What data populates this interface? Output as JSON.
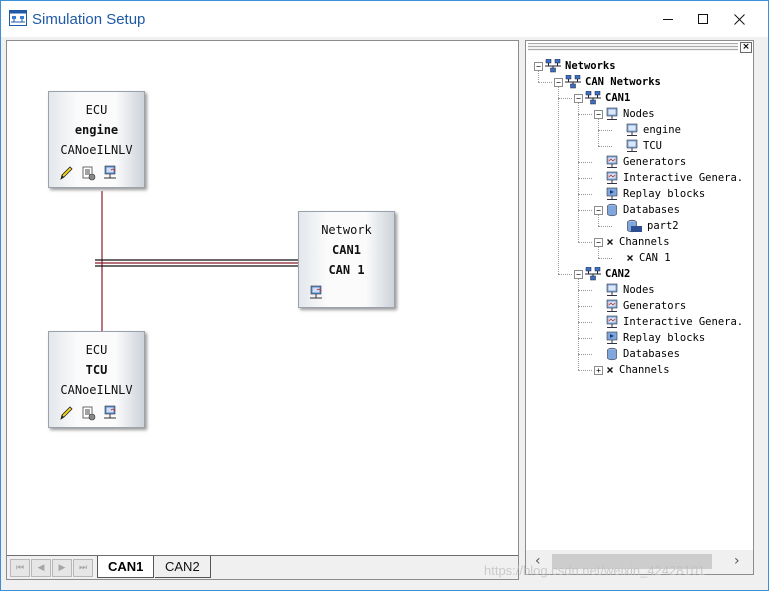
{
  "window": {
    "title": "Simulation Setup",
    "controls": {
      "minimize": "—",
      "maximize": "☐",
      "close": "✕"
    }
  },
  "canvas": {
    "blocks": [
      {
        "id": "ecu-engine",
        "line1": "ECU",
        "line2": "engine",
        "line3": "CANoeILNLV",
        "icons": [
          "pencil-icon",
          "configure-icon",
          "network-node-icon"
        ]
      },
      {
        "id": "network-can1",
        "line1": "Network",
        "line2": "CAN1",
        "line3": "CAN 1",
        "icons": [
          "network-node-icon"
        ]
      },
      {
        "id": "ecu-tcu",
        "line1": "ECU",
        "line2": "TCU",
        "line3": "CANoeILNLV",
        "icons": [
          "pencil-icon",
          "configure-icon",
          "network-node-icon"
        ]
      }
    ],
    "bus_color": "#8b1a2b"
  },
  "tabs": {
    "nav": [
      "⏮",
      "◀",
      "▶",
      "⏭"
    ],
    "items": [
      {
        "label": "CAN1",
        "active": true
      },
      {
        "label": "CAN2",
        "active": false
      }
    ]
  },
  "tree": {
    "nodes": [
      {
        "label": "Networks",
        "bold": true,
        "icon": "networks-icon",
        "expander": "−"
      },
      {
        "label": "CAN Networks",
        "bold": true,
        "icon": "networks-icon",
        "expander": "−"
      },
      {
        "label": "CAN1",
        "bold": true,
        "icon": "networks-icon",
        "expander": "−"
      },
      {
        "label": "Nodes",
        "bold": false,
        "icon": "computer-icon",
        "expander": "−"
      },
      {
        "label": "engine",
        "bold": false,
        "icon": "computer-icon",
        "expander": ""
      },
      {
        "label": "TCU",
        "bold": false,
        "icon": "computer-icon",
        "expander": ""
      },
      {
        "label": "Generators",
        "bold": false,
        "icon": "generator-icon",
        "expander": ""
      },
      {
        "label": "Interactive Genera.",
        "bold": false,
        "icon": "generator-icon",
        "expander": ""
      },
      {
        "label": "Replay blocks",
        "bold": false,
        "icon": "replay-icon",
        "expander": ""
      },
      {
        "label": "Databases",
        "bold": false,
        "icon": "database-icon",
        "expander": "−"
      },
      {
        "label": "part2",
        "bold": false,
        "icon": "dbc-icon",
        "expander": ""
      },
      {
        "label": "Channels",
        "bold": false,
        "icon": "channel-icon",
        "expander": "−"
      },
      {
        "label": "CAN 1",
        "bold": false,
        "icon": "channel-icon",
        "expander": ""
      },
      {
        "label": "CAN2",
        "bold": true,
        "icon": "networks-icon",
        "expander": "−"
      },
      {
        "label": "Nodes",
        "bold": false,
        "icon": "computer-icon",
        "expander": ""
      },
      {
        "label": "Generators",
        "bold": false,
        "icon": "generator-icon",
        "expander": ""
      },
      {
        "label": "Interactive Genera.",
        "bold": false,
        "icon": "generator-icon",
        "expander": ""
      },
      {
        "label": "Replay blocks",
        "bold": false,
        "icon": "replay-icon",
        "expander": ""
      },
      {
        "label": "Databases",
        "bold": false,
        "icon": "database-icon",
        "expander": ""
      },
      {
        "label": "Channels",
        "bold": false,
        "icon": "channel-icon",
        "expander": "+"
      }
    ]
  },
  "scroll": {
    "left": "‹",
    "right": "›"
  },
  "panel_close": "×",
  "watermark": "https://blog.csdn.net/weixin_42428101"
}
